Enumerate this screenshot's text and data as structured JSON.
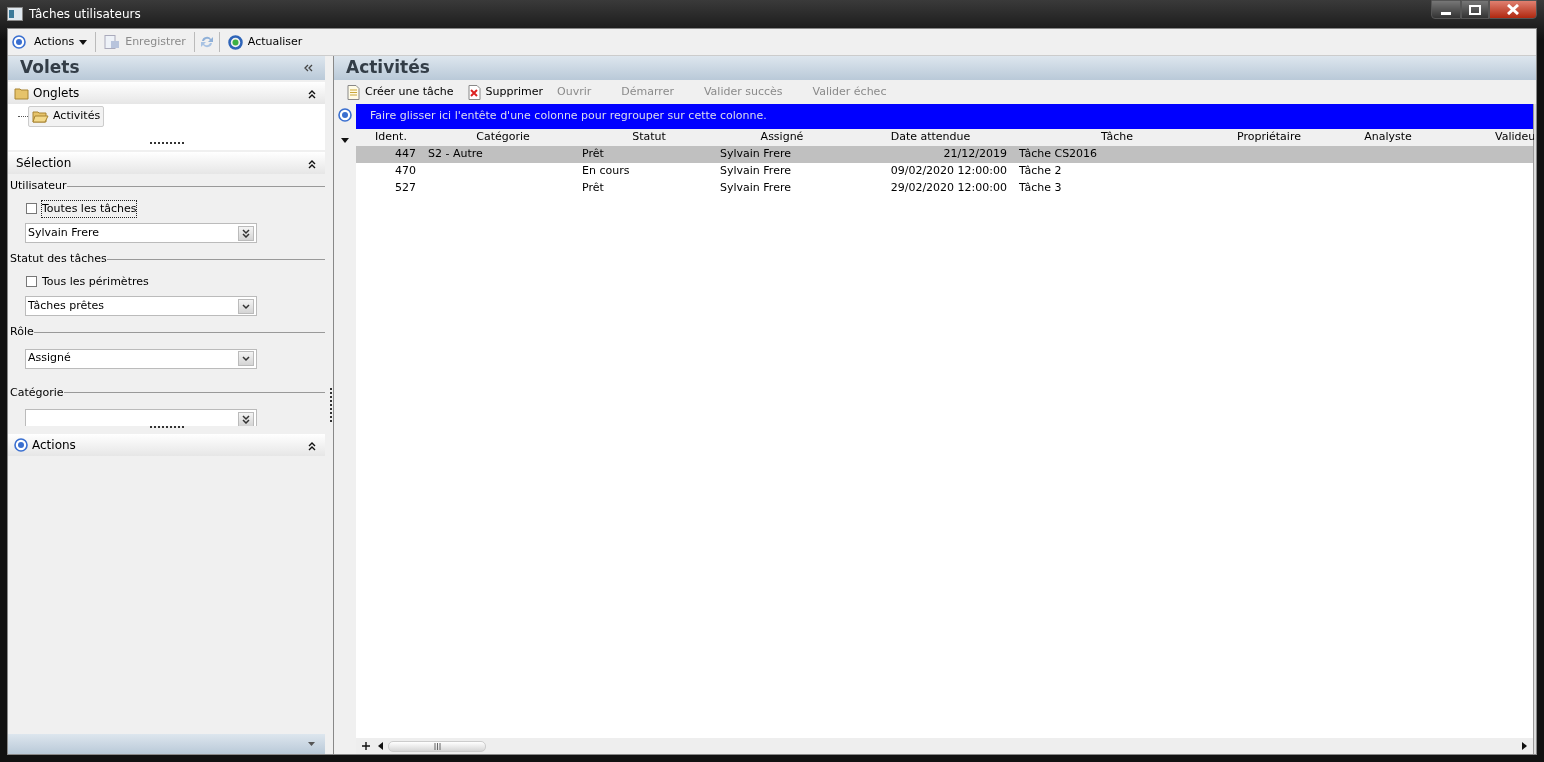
{
  "window": {
    "title": "Tâches utilisateurs"
  },
  "toolbar": [
    {
      "kind": "menu",
      "label": "Actions",
      "disabled": false
    },
    {
      "kind": "save",
      "label": "Enregistrer",
      "disabled": true
    },
    {
      "kind": "refresh",
      "label": "Actualiser",
      "disabled": false
    }
  ],
  "left_panel": {
    "title": "Volets",
    "onglets": {
      "title": "Onglets",
      "items": [
        {
          "label": "Activités",
          "selected": true
        }
      ]
    },
    "selection": {
      "title": "Sélection",
      "groups": [
        {
          "label": "Utilisateur",
          "checkbox": {
            "label": "Toutes les tâches",
            "checked": false,
            "focused": true
          },
          "dropdown": {
            "value": "Sylvain Frere",
            "kind": "multi"
          }
        },
        {
          "label": "Statut des tâches",
          "checkbox": {
            "label": "Tous les périmètres",
            "checked": false,
            "focused": false
          },
          "dropdown": {
            "value": "Tâches prêtes",
            "kind": "single"
          }
        },
        {
          "label": "Rôle",
          "dropdown": {
            "value": "Assigné",
            "kind": "single"
          }
        },
        {
          "label": "Catégorie",
          "dropdown": {
            "kind": "multi"
          }
        }
      ]
    },
    "actions": {
      "title": "Actions"
    }
  },
  "main": {
    "title": "Activités",
    "actions": [
      {
        "kind": "create",
        "label": "Créer une tâche",
        "disabled": false
      },
      {
        "kind": "delete",
        "label": "Supprimer",
        "disabled": false
      },
      {
        "kind": "plain",
        "label": "Ouvrir",
        "disabled": true
      },
      {
        "kind": "plain",
        "label": "Démarrer",
        "disabled": true
      },
      {
        "kind": "plain",
        "label": "Valider succès",
        "disabled": true
      },
      {
        "kind": "plain",
        "label": "Valider échec",
        "disabled": true
      }
    ],
    "group_hint": "Faire glisser ici l'entête d'une colonne pour regrouper sur cette colonne.",
    "table": {
      "columns": [
        "Ident.",
        "Catégorie",
        "Statut",
        "Assigné",
        "Date attendue",
        "Tâche",
        "Propriétaire",
        "Analyste",
        "Valideu"
      ],
      "rows": [
        {
          "selected": true,
          "cells": [
            "447",
            "S2 - Autre",
            "Prêt",
            "Sylvain Frere",
            "21/12/2019",
            "Tâche CS2016",
            "",
            "",
            ""
          ]
        },
        {
          "selected": false,
          "cells": [
            "470",
            "",
            "En cours",
            "Sylvain Frere",
            "09/02/2020 12:00:00",
            "Tâche 2",
            "",
            "",
            ""
          ]
        },
        {
          "selected": false,
          "cells": [
            "527",
            "",
            "Prêt",
            "Sylvain Frere",
            "29/02/2020 12:00:00",
            "Tâche 3",
            "",
            "",
            ""
          ]
        }
      ]
    }
  }
}
